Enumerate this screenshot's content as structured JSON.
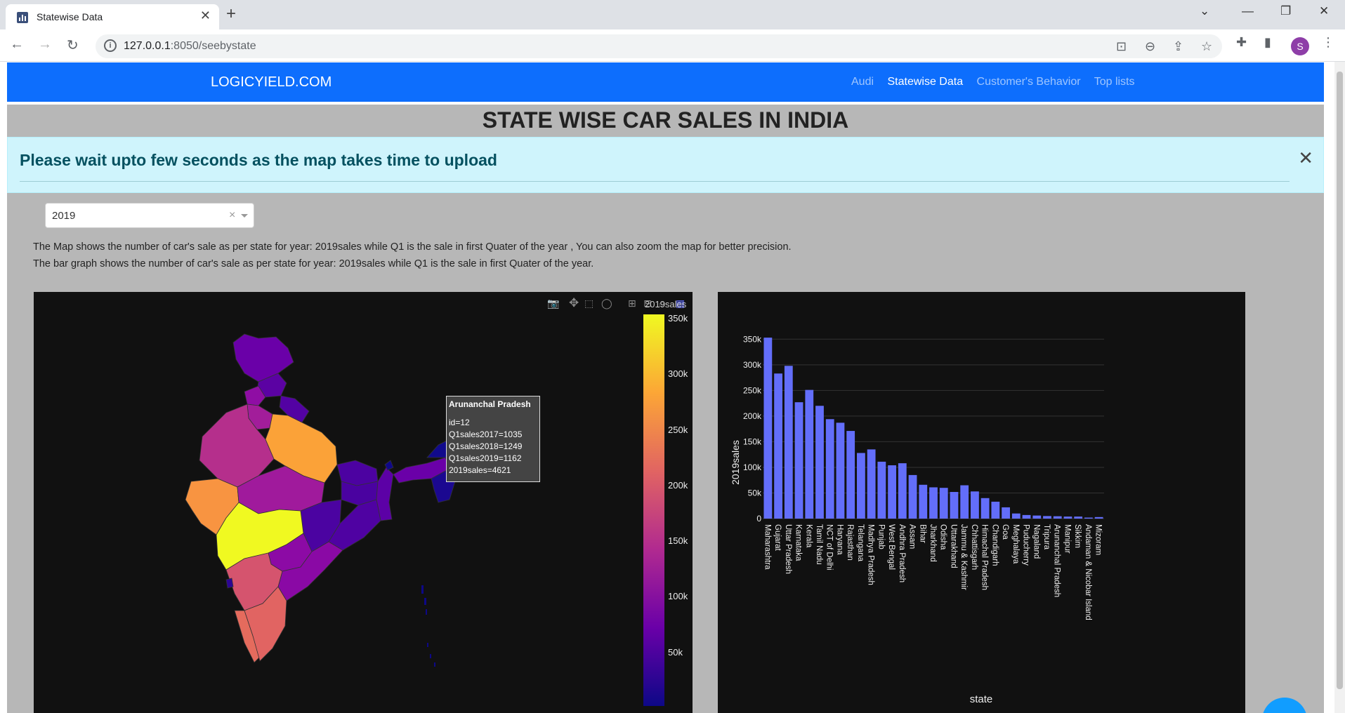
{
  "browser": {
    "tab_title": "Statewise Data",
    "url_host": "127.0.0.1",
    "url_rest": ":8050/seebystate",
    "avatar_letter": "S"
  },
  "navbar": {
    "brand": "LOGICYIELD.COM",
    "links": [
      {
        "label": "Audi",
        "active": false
      },
      {
        "label": "Statewise Data",
        "active": true
      },
      {
        "label": "Customer's Behavior",
        "active": false
      },
      {
        "label": "Top lists",
        "active": false
      }
    ],
    "color": "#0d6efd"
  },
  "page": {
    "title": "STATE WISE CAR SALES IN INDIA",
    "alert": "Please wait upto few seconds as the map takes time to upload",
    "dropdown_value": "2019",
    "desc_map": "The Map shows the number of car's sale as per state for year: 2019sales while Q1 is the sale in first Quater of the year , You can also zoom the map for better precision.",
    "desc_bar": "The bar graph shows the number of car's sale as per state for year: 2019sales while Q1 is the sale in first Quater of the year."
  },
  "map": {
    "colorbar_title": "2019sales",
    "colorbar_ticks": [
      "350k",
      "300k",
      "250k",
      "200k",
      "150k",
      "100k",
      "50k"
    ],
    "colorscale": [
      "#0d0887",
      "#6a00a8",
      "#b12a90",
      "#e16462",
      "#fca636",
      "#f0f921"
    ],
    "tooltip": {
      "title": "Arunanchal Pradesh",
      "lines": [
        "id=12",
        "Q1sales2017=1035",
        "Q1sales2018=1249",
        "Q1sales2019=1162",
        "2019sales=4621"
      ]
    }
  },
  "chart_data": {
    "type": "bar",
    "xlabel": "state",
    "ylabel": "2019sales",
    "ylim": [
      0,
      360000
    ],
    "yticks": [
      0,
      50000,
      100000,
      150000,
      200000,
      250000,
      300000,
      350000
    ],
    "ytick_labels": [
      "0",
      "50k",
      "100k",
      "150k",
      "200k",
      "250k",
      "300k",
      "350k"
    ],
    "bar_color": "#636efa",
    "categories": [
      "Maharashtra",
      "Gujarat",
      "Uttar Pradesh",
      "Karnataka",
      "Kerala",
      "Tamil Nadu",
      "NCT of Delhi",
      "Haryana",
      "Rajasthan",
      "Telangana",
      "Madhya Pradesh",
      "Punjab",
      "West Bengal",
      "Andhra Pradesh",
      "Assam",
      "Bihar",
      "Jharkhand",
      "Odisha",
      "Uttarakhand",
      "Jammu & Kashmir",
      "Chhattisgarh",
      "Himachal Pradesh",
      "Chandigarh",
      "Goa",
      "Meghalaya",
      "Puducherry",
      "Nagaland",
      "Tripura",
      "Arunanchal Pradesh",
      "Manipur",
      "Sikkim",
      "Andaman & Nicobar Island",
      "Mizoram"
    ],
    "values": [
      353000,
      283000,
      298000,
      227000,
      251000,
      220000,
      194000,
      187000,
      171000,
      128000,
      135000,
      111000,
      104000,
      108000,
      85000,
      66000,
      61000,
      60000,
      52000,
      65000,
      53000,
      40000,
      33000,
      22000,
      10000,
      7000,
      6000,
      5000,
      4621,
      4000,
      4000,
      2000,
      3000
    ]
  }
}
